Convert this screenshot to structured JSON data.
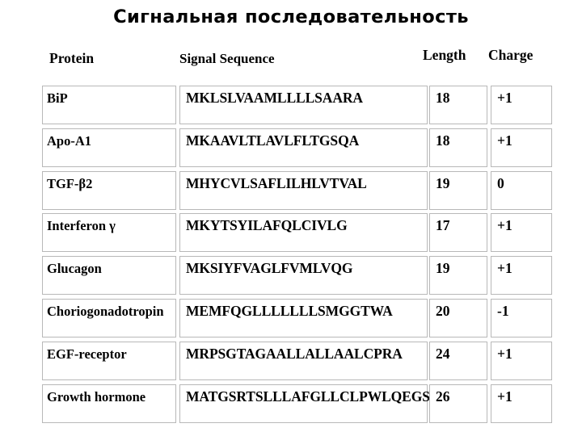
{
  "title": "Сигнальная последовательность",
  "table": {
    "headers": {
      "protein": "Protein",
      "sequence": "Signal Sequence",
      "length": "Length",
      "charge": "Charge"
    },
    "rows": [
      {
        "protein": "BiP",
        "sequence": "MKLSLVAAMLLLLSAARA",
        "length": "18",
        "charge": "+1"
      },
      {
        "protein": "Apo-A1",
        "sequence": "MKAAVLTLAVLFLTGSQA",
        "length": "18",
        "charge": "+1"
      },
      {
        "protein": "TGF-β2",
        "sequence": "MHYCVLSAFLILHLVTVAL",
        "length": "19",
        "charge": "0"
      },
      {
        "protein": "Interferon γ",
        "sequence": "MKYTSYILAFQLCIVLG",
        "length": "17",
        "charge": "+1"
      },
      {
        "protein": "Glucagon",
        "sequence": "MKSIYFVAGLFVMLVQG",
        "length": "19",
        "charge": "+1"
      },
      {
        "protein": "Choriogonadotropin",
        "sequence": "MEMFQGLLLLLLLSMGGTWA",
        "length": "20",
        "charge": "-1"
      },
      {
        "protein": "EGF-receptor",
        "sequence": "MRPSGTAGAALLALLAALCPRA",
        "length": "24",
        "charge": "+1"
      },
      {
        "protein": "Growth hormone",
        "sequence": "MATGSRTSLLLAFGLLCLPWLQEGSA",
        "length": "26",
        "charge": "+1"
      }
    ]
  },
  "colors": {
    "background": "#ffffff",
    "text": "#000000",
    "cell_border": "#b8b8b8"
  }
}
